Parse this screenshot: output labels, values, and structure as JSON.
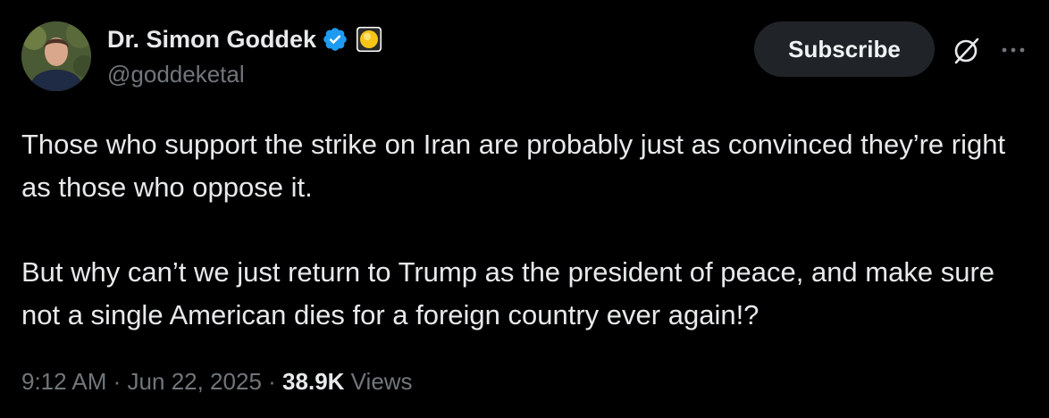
{
  "author": {
    "display_name": "Dr. Simon Goddek",
    "handle": "@goddeketal",
    "avatar_icon": "profile-photo",
    "verified_icon": "verified-checkmark-icon",
    "badge_icon": "gold-badge-icon"
  },
  "actions": {
    "subscribe_label": "Subscribe",
    "grok_icon": "grok-icon",
    "more_icon": "more-options-icon"
  },
  "tweet": {
    "paragraphs": [
      "Those who support the strike on Iran are probably just as convinced they’re right as those who oppose it.",
      "But why can’t we just return to Trump as the president of peace, and make sure not a single American dies for a foreign country ever again!?"
    ]
  },
  "meta": {
    "time": "9:12 AM",
    "separator": "·",
    "date": "Jun 22, 2025",
    "views_count": "38.9K",
    "views_label": "Views"
  },
  "colors": {
    "background": "#000000",
    "primary_text": "#e7e9ea",
    "secondary_text": "#71767b",
    "verified_blue": "#1d9bf0",
    "subscribe_bg": "#202327"
  }
}
